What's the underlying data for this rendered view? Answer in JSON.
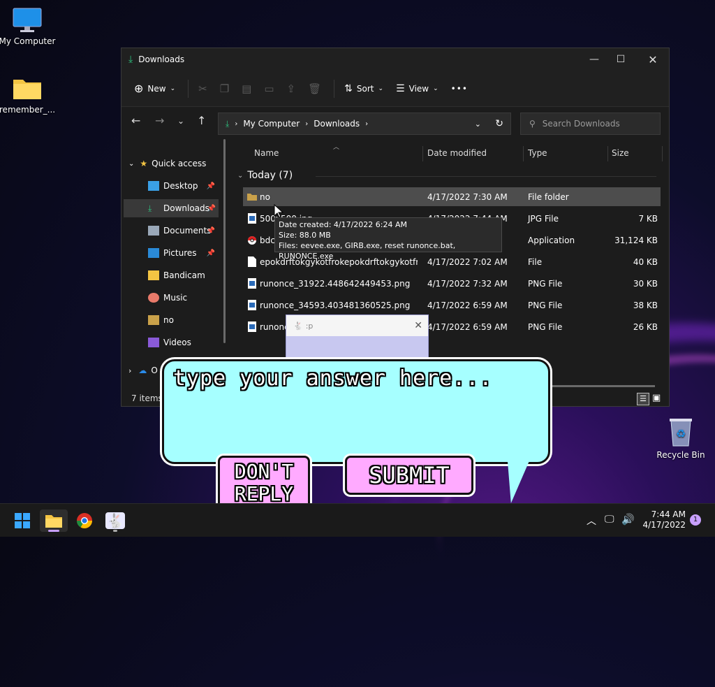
{
  "desktop": {
    "icons": [
      {
        "label": "My Computer"
      },
      {
        "label": "remember_..."
      },
      {
        "label": "Recycle Bin"
      }
    ]
  },
  "window": {
    "title": "Downloads",
    "toolbar": {
      "new_label": "New",
      "sort_label": "Sort",
      "view_label": "View",
      "more_label": "•••"
    },
    "breadcrumb": [
      "My Computer",
      "Downloads"
    ],
    "search_placeholder": "Search Downloads",
    "sidebar": {
      "quick_access": "Quick access",
      "items": [
        {
          "label": "Desktop",
          "pinned": true
        },
        {
          "label": "Downloads",
          "pinned": true,
          "selected": true
        },
        {
          "label": "Documents",
          "pinned": true
        },
        {
          "label": "Pictures",
          "pinned": true
        },
        {
          "label": "Bandicam",
          "pinned": false
        },
        {
          "label": "Music",
          "pinned": false
        },
        {
          "label": "no",
          "pinned": false
        },
        {
          "label": "Videos",
          "pinned": false
        }
      ],
      "onedrive": "O"
    },
    "columns": {
      "name": "Name",
      "date": "Date modified",
      "type": "Type",
      "size": "Size"
    },
    "group_label": "Today (7)",
    "files": [
      {
        "name": "no",
        "date": "4/17/2022 7:30 AM",
        "type": "File folder",
        "size": "",
        "icon": "folder"
      },
      {
        "name": "500x500.jpg",
        "date": "4/17/2022 7:44 AM",
        "type": "JPG File",
        "size": "7 KB",
        "icon": "image"
      },
      {
        "name": "bdc",
        "date": "",
        "type": "Application",
        "size": "31,124 KB",
        "icon": "app"
      },
      {
        "name": "epokdrftokgykotfrokepokdrftokgykotfro...",
        "date": "4/17/2022 7:02 AM",
        "type": "File",
        "size": "40 KB",
        "icon": "file"
      },
      {
        "name": "runonce_31922.448642449453.png",
        "date": "4/17/2022 7:32 AM",
        "type": "PNG File",
        "size": "30 KB",
        "icon": "image"
      },
      {
        "name": "runonce_34593.403481360525.png",
        "date": "4/17/2022 6:59 AM",
        "type": "PNG File",
        "size": "38 KB",
        "icon": "image"
      },
      {
        "name": "runonce",
        "date": "4/17/2022 6:59 AM",
        "type": "PNG File",
        "size": "26 KB",
        "icon": "image"
      }
    ],
    "status_text": "7 items",
    "tooltip": {
      "line1": "Date created: 4/17/2022 6:24 AM",
      "line2": "Size: 88.0 MB",
      "line3": "Files: eevee.exe, GIRB.exe, reset runonce.bat, RUNONCE.exe"
    }
  },
  "mini_window": {
    "title": ":p"
  },
  "bubble": {
    "prompt": "type your answer here...",
    "dont_reply": "DON'T REPLY",
    "submit": "SUBMIT"
  },
  "taskbar": {
    "time": "7:44 AM",
    "date": "4/17/2022",
    "notification_count": "1"
  }
}
